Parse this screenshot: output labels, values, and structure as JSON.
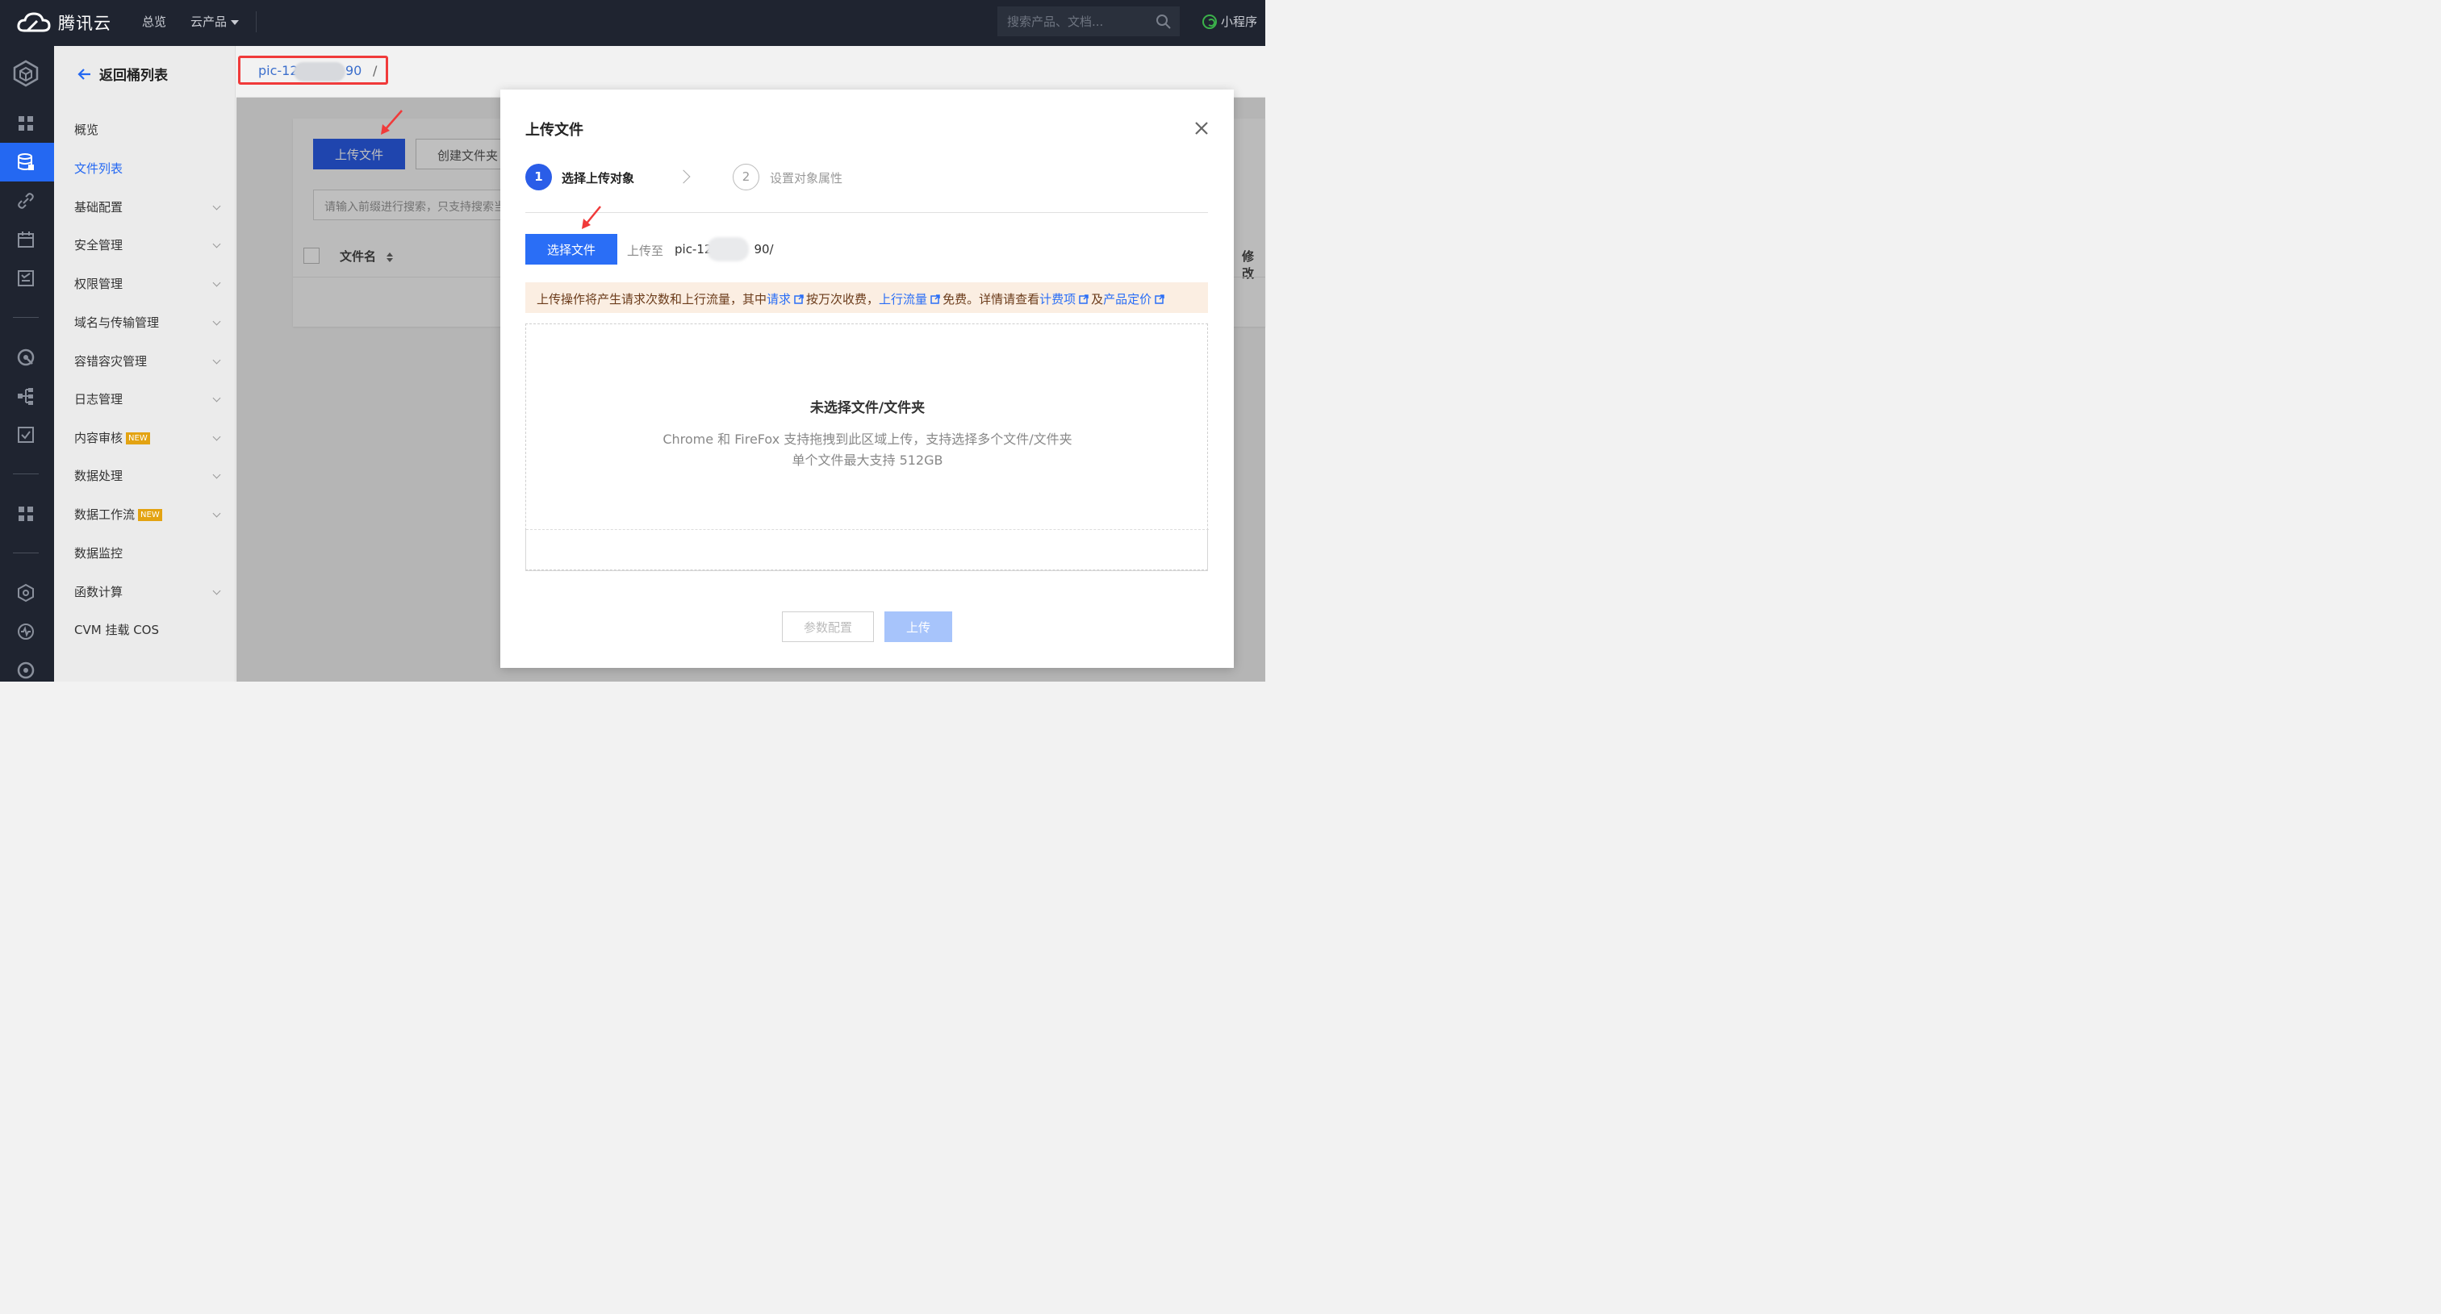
{
  "topbar": {
    "brand": "腾讯云",
    "nav_overview": "总览",
    "nav_products": "云产品",
    "search_placeholder": "搜索产品、文档...",
    "mini_program": "小程序"
  },
  "sidebar": {
    "back_label": "返回桶列表",
    "items": [
      {
        "label": "概览",
        "has_caret": false
      },
      {
        "label": "文件列表",
        "has_caret": false,
        "active": true
      },
      {
        "label": "基础配置",
        "has_caret": true
      },
      {
        "label": "安全管理",
        "has_caret": true
      },
      {
        "label": "权限管理",
        "has_caret": true
      },
      {
        "label": "域名与传输管理",
        "has_caret": true
      },
      {
        "label": "容错容灾管理",
        "has_caret": true
      },
      {
        "label": "日志管理",
        "has_caret": true
      },
      {
        "label": "内容审核",
        "has_caret": true,
        "badge": "NEW"
      },
      {
        "label": "数据处理",
        "has_caret": true
      },
      {
        "label": "数据工作流",
        "has_caret": true,
        "badge": "NEW"
      },
      {
        "label": "数据监控",
        "has_caret": false
      },
      {
        "label": "函数计算",
        "has_caret": true
      },
      {
        "label": "CVM 挂载 COS",
        "has_caret": false
      }
    ]
  },
  "breadcrumb": {
    "bucket_prefix": "pic-12",
    "bucket_suffix": "90",
    "separator": "/"
  },
  "file_list": {
    "upload_button": "上传文件",
    "create_folder_button": "创建文件夹",
    "search_placeholder": "请输入前缀进行搜索，只支持搜索当前目录",
    "col_filename": "文件名",
    "col_modified": "修改"
  },
  "modal": {
    "title": "上传文件",
    "step1_number": "1",
    "step1_label": "选择上传对象",
    "step2_number": "2",
    "step2_label": "设置对象属性",
    "select_file_button": "选择文件",
    "upload_to_label": "上传至",
    "upload_path_prefix": "pic-12",
    "upload_path_suffix": "90/",
    "notice": {
      "part1": "上传操作将产生请求次数和上行流量，其中",
      "link1": "请求",
      "part2": "按万次收费，",
      "link2": "上行流量",
      "part3": "免费。详情请查看",
      "link3": "计费项",
      "part4": "及",
      "link4": "产品定价"
    },
    "dropzone_title": "未选择文件/文件夹",
    "dropzone_hint1": "Chrome 和 FireFox 支持拖拽到此区域上传，支持选择多个文件/文件夹",
    "dropzone_hint2": "单个文件最大支持 512GB",
    "param_config_button": "参数配置",
    "upload_button": "上传"
  },
  "colors": {
    "primary": "#2a6ef6",
    "topbar_bg": "#1f2430",
    "annotation_red": "#f03a3a",
    "notice_bg": "#fbeee2"
  }
}
